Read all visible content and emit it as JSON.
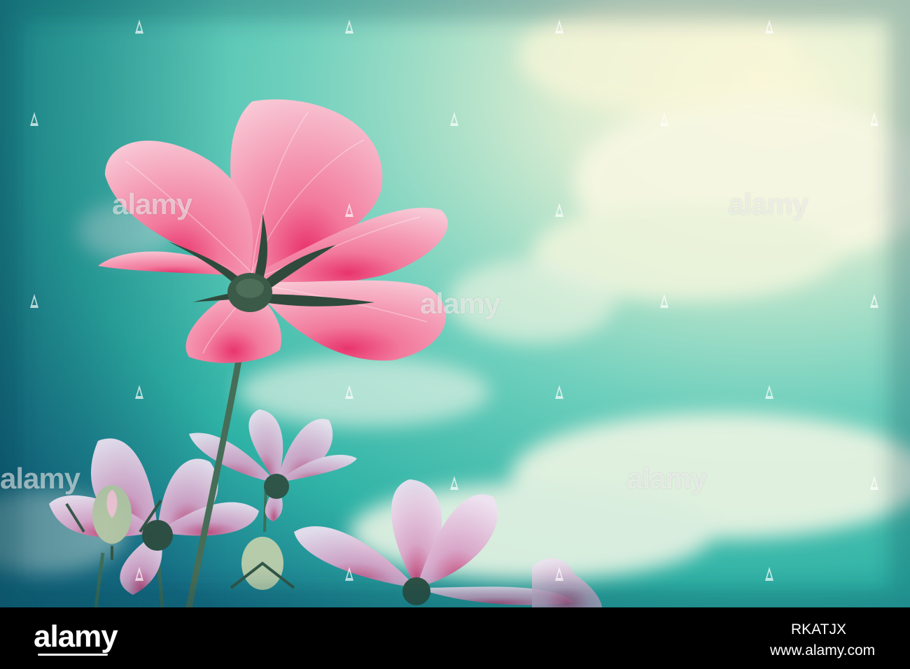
{
  "watermark": {
    "text": "alamy"
  },
  "footer": {
    "logo_text": "alamy",
    "image_id": "RKATJX",
    "site": "www.alamy.com"
  },
  "colors": {
    "sky_teal": "#2fb7a7",
    "sky_dark": "#1a6e82",
    "cloud": "#f3f6e6",
    "petal_pink": "#f3a5bd",
    "petal_center": "#e3306b",
    "footer_bg": "#000000"
  }
}
